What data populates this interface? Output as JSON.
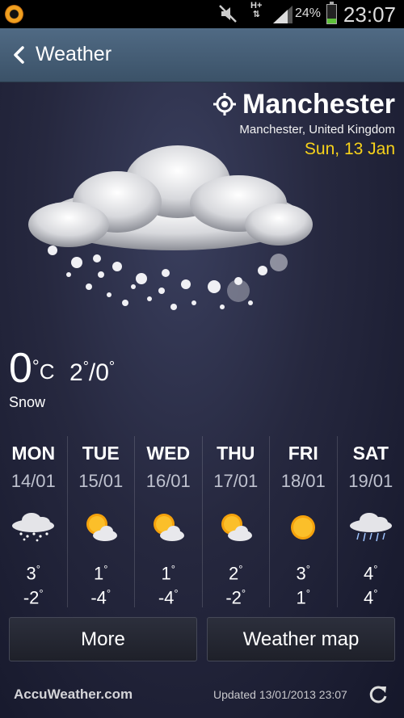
{
  "status_bar": {
    "network": "H+",
    "battery_percent": "24%",
    "battery_level": 0.24,
    "time": "23:07"
  },
  "header": {
    "title": "Weather"
  },
  "location": {
    "city": "Manchester",
    "region": "Manchester, United Kingdom",
    "date": "Sun, 13 Jan"
  },
  "current": {
    "temp": "0",
    "unit": "C",
    "high": "2",
    "low": "0",
    "condition": "Snow"
  },
  "forecast": [
    {
      "day": "MON",
      "date": "14/01",
      "hi": "3",
      "lo": "-2",
      "icon": "snow-cloud-icon"
    },
    {
      "day": "TUE",
      "date": "15/01",
      "hi": "1",
      "lo": "-4",
      "icon": "sun-cloud-icon"
    },
    {
      "day": "WED",
      "date": "16/01",
      "hi": "1",
      "lo": "-4",
      "icon": "sun-cloud-icon"
    },
    {
      "day": "THU",
      "date": "17/01",
      "hi": "2",
      "lo": "-2",
      "icon": "sun-cloud-icon"
    },
    {
      "day": "FRI",
      "date": "18/01",
      "hi": "3",
      "lo": "1",
      "icon": "sun-icon"
    },
    {
      "day": "SAT",
      "date": "19/01",
      "hi": "4",
      "lo": "4",
      "icon": "rain-cloud-icon"
    }
  ],
  "buttons": {
    "more": "More",
    "map": "Weather map"
  },
  "footer": {
    "brand": "AccuWeather.com",
    "updated": "Updated 13/01/2013 23:07"
  },
  "colors": {
    "date_accent": "#f7d21a",
    "header_bg": "#3b5268",
    "battery": "#5ec13a"
  }
}
